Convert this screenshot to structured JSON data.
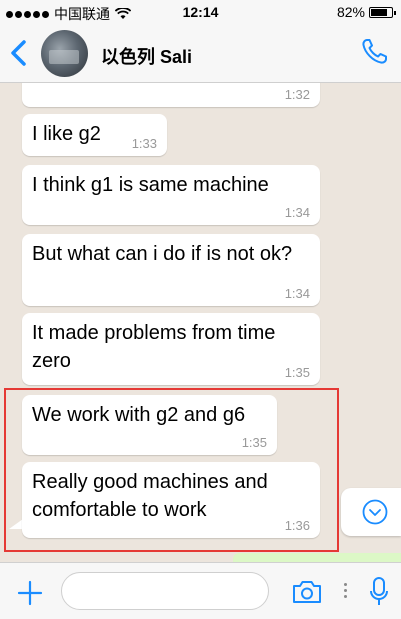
{
  "status_bar": {
    "carrier": "中国联通",
    "time": "12:14",
    "battery": "82%",
    "battery_level": 0.82
  },
  "header": {
    "contact_name": "以色列 Sali",
    "back_icon": "chevron-left-icon",
    "call_icon": "phone-icon"
  },
  "messages": [
    {
      "text": "",
      "time": "1:32"
    },
    {
      "text": "I like g2",
      "time": "1:33"
    },
    {
      "text": "I think g1 is same machine",
      "time": "1:34"
    },
    {
      "text": "But what can i do if is not ok?",
      "time": "1:34"
    },
    {
      "text": "It made problems from time zero",
      "time": "1:35"
    },
    {
      "text": "We work with g2 and g6",
      "time": "1:35"
    },
    {
      "text": "Really good machines and comfortable to work",
      "time": "1:36"
    }
  ],
  "input": {
    "value": "",
    "placeholder": ""
  },
  "colors": {
    "accent": "#1a8cff",
    "chat_bg": "#ece5dd",
    "highlight": "#e53935"
  }
}
